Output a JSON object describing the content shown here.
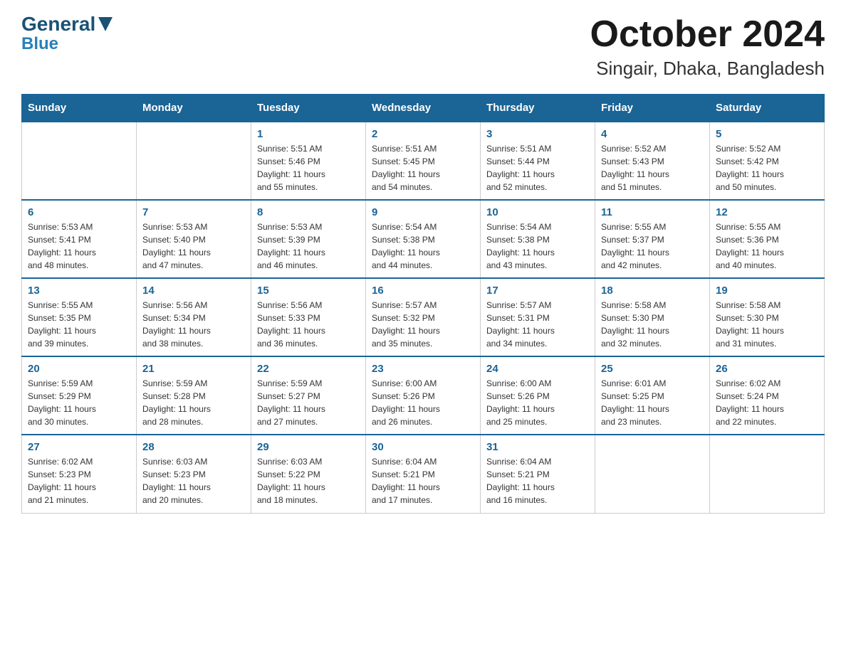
{
  "logo": {
    "general": "General",
    "blue": "Blue"
  },
  "title": "October 2024",
  "subtitle": "Singair, Dhaka, Bangladesh",
  "days": [
    "Sunday",
    "Monday",
    "Tuesday",
    "Wednesday",
    "Thursday",
    "Friday",
    "Saturday"
  ],
  "weeks": [
    [
      {
        "num": "",
        "info": ""
      },
      {
        "num": "",
        "info": ""
      },
      {
        "num": "1",
        "info": "Sunrise: 5:51 AM\nSunset: 5:46 PM\nDaylight: 11 hours\nand 55 minutes."
      },
      {
        "num": "2",
        "info": "Sunrise: 5:51 AM\nSunset: 5:45 PM\nDaylight: 11 hours\nand 54 minutes."
      },
      {
        "num": "3",
        "info": "Sunrise: 5:51 AM\nSunset: 5:44 PM\nDaylight: 11 hours\nand 52 minutes."
      },
      {
        "num": "4",
        "info": "Sunrise: 5:52 AM\nSunset: 5:43 PM\nDaylight: 11 hours\nand 51 minutes."
      },
      {
        "num": "5",
        "info": "Sunrise: 5:52 AM\nSunset: 5:42 PM\nDaylight: 11 hours\nand 50 minutes."
      }
    ],
    [
      {
        "num": "6",
        "info": "Sunrise: 5:53 AM\nSunset: 5:41 PM\nDaylight: 11 hours\nand 48 minutes."
      },
      {
        "num": "7",
        "info": "Sunrise: 5:53 AM\nSunset: 5:40 PM\nDaylight: 11 hours\nand 47 minutes."
      },
      {
        "num": "8",
        "info": "Sunrise: 5:53 AM\nSunset: 5:39 PM\nDaylight: 11 hours\nand 46 minutes."
      },
      {
        "num": "9",
        "info": "Sunrise: 5:54 AM\nSunset: 5:38 PM\nDaylight: 11 hours\nand 44 minutes."
      },
      {
        "num": "10",
        "info": "Sunrise: 5:54 AM\nSunset: 5:38 PM\nDaylight: 11 hours\nand 43 minutes."
      },
      {
        "num": "11",
        "info": "Sunrise: 5:55 AM\nSunset: 5:37 PM\nDaylight: 11 hours\nand 42 minutes."
      },
      {
        "num": "12",
        "info": "Sunrise: 5:55 AM\nSunset: 5:36 PM\nDaylight: 11 hours\nand 40 minutes."
      }
    ],
    [
      {
        "num": "13",
        "info": "Sunrise: 5:55 AM\nSunset: 5:35 PM\nDaylight: 11 hours\nand 39 minutes."
      },
      {
        "num": "14",
        "info": "Sunrise: 5:56 AM\nSunset: 5:34 PM\nDaylight: 11 hours\nand 38 minutes."
      },
      {
        "num": "15",
        "info": "Sunrise: 5:56 AM\nSunset: 5:33 PM\nDaylight: 11 hours\nand 36 minutes."
      },
      {
        "num": "16",
        "info": "Sunrise: 5:57 AM\nSunset: 5:32 PM\nDaylight: 11 hours\nand 35 minutes."
      },
      {
        "num": "17",
        "info": "Sunrise: 5:57 AM\nSunset: 5:31 PM\nDaylight: 11 hours\nand 34 minutes."
      },
      {
        "num": "18",
        "info": "Sunrise: 5:58 AM\nSunset: 5:30 PM\nDaylight: 11 hours\nand 32 minutes."
      },
      {
        "num": "19",
        "info": "Sunrise: 5:58 AM\nSunset: 5:30 PM\nDaylight: 11 hours\nand 31 minutes."
      }
    ],
    [
      {
        "num": "20",
        "info": "Sunrise: 5:59 AM\nSunset: 5:29 PM\nDaylight: 11 hours\nand 30 minutes."
      },
      {
        "num": "21",
        "info": "Sunrise: 5:59 AM\nSunset: 5:28 PM\nDaylight: 11 hours\nand 28 minutes."
      },
      {
        "num": "22",
        "info": "Sunrise: 5:59 AM\nSunset: 5:27 PM\nDaylight: 11 hours\nand 27 minutes."
      },
      {
        "num": "23",
        "info": "Sunrise: 6:00 AM\nSunset: 5:26 PM\nDaylight: 11 hours\nand 26 minutes."
      },
      {
        "num": "24",
        "info": "Sunrise: 6:00 AM\nSunset: 5:26 PM\nDaylight: 11 hours\nand 25 minutes."
      },
      {
        "num": "25",
        "info": "Sunrise: 6:01 AM\nSunset: 5:25 PM\nDaylight: 11 hours\nand 23 minutes."
      },
      {
        "num": "26",
        "info": "Sunrise: 6:02 AM\nSunset: 5:24 PM\nDaylight: 11 hours\nand 22 minutes."
      }
    ],
    [
      {
        "num": "27",
        "info": "Sunrise: 6:02 AM\nSunset: 5:23 PM\nDaylight: 11 hours\nand 21 minutes."
      },
      {
        "num": "28",
        "info": "Sunrise: 6:03 AM\nSunset: 5:23 PM\nDaylight: 11 hours\nand 20 minutes."
      },
      {
        "num": "29",
        "info": "Sunrise: 6:03 AM\nSunset: 5:22 PM\nDaylight: 11 hours\nand 18 minutes."
      },
      {
        "num": "30",
        "info": "Sunrise: 6:04 AM\nSunset: 5:21 PM\nDaylight: 11 hours\nand 17 minutes."
      },
      {
        "num": "31",
        "info": "Sunrise: 6:04 AM\nSunset: 5:21 PM\nDaylight: 11 hours\nand 16 minutes."
      },
      {
        "num": "",
        "info": ""
      },
      {
        "num": "",
        "info": ""
      }
    ]
  ]
}
